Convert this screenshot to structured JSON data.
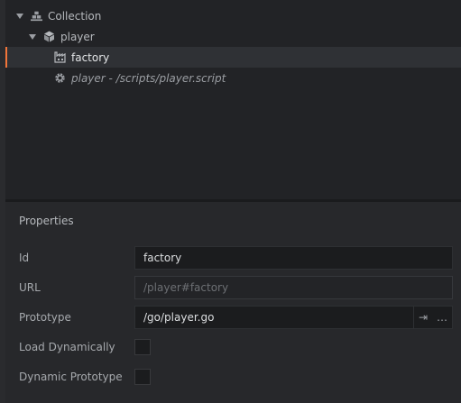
{
  "outline": {
    "collection": {
      "label": "Collection",
      "icon": "collection-icon"
    },
    "player": {
      "label": "player",
      "icon": "game-object-icon"
    },
    "factory": {
      "label": "factory",
      "icon": "factory-icon"
    },
    "script": {
      "label": "player - /scripts/player.script",
      "icon": "gear-icon"
    }
  },
  "properties": {
    "title": "Properties",
    "id_label": "Id",
    "id_value": "factory",
    "url_label": "URL",
    "url_value": "/player#factory",
    "prototype_label": "Prototype",
    "prototype_value": "/go/player.go",
    "goto_glyph": "⇥",
    "browse_glyph": "…",
    "load_dynamically_label": "Load Dynamically",
    "load_dynamically_checked": false,
    "dynamic_prototype_label": "Dynamic Prototype",
    "dynamic_prototype_checked": false
  },
  "colors": {
    "selection_accent": "#f2753a",
    "background": "#222326"
  }
}
